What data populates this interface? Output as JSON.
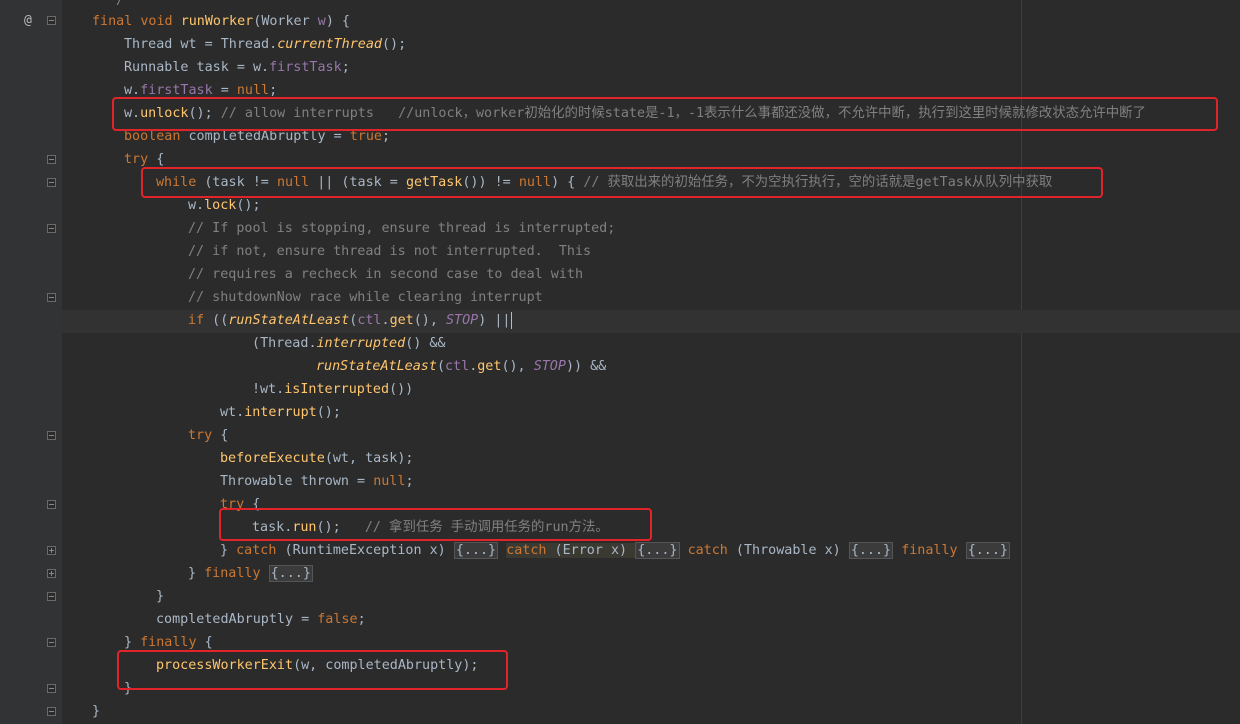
{
  "gutter": {
    "override_marker": "@"
  },
  "code": {
    "l0": "*/",
    "l1": {
      "k1": "final",
      "k2": "void",
      "fn": "runWorker",
      "p1": "(",
      "ty": "Worker",
      "v": "w",
      "p2": ") {"
    },
    "l2": {
      "ty": "Thread",
      "v": " wt = ",
      "cls": "Thread",
      "dot": ".",
      "fn": "currentThread",
      "end": "();"
    },
    "l3": {
      "ty": "Runnable",
      "v": " task = w.",
      "fld": "firstTask",
      "end": ";"
    },
    "l4": {
      "v": "w.",
      "fld": "firstTask",
      "eq": " = ",
      "kw": "null",
      "end": ";"
    },
    "l5": {
      "v": "w.",
      "fn": "unlock",
      "end": "(); ",
      "cmt": "// allow interrupts   //unlock，worker初始化的时候state是-1，-1表示什么事都还没做，不允许中断，执行到这里时候就修改状态允许中断了"
    },
    "l6": {
      "kw": "boolean",
      "v": " completedAbruptly = ",
      "kw2": "true",
      "end": ";"
    },
    "l7": {
      "kw": "try",
      "end": " {"
    },
    "l8": {
      "kw": "while",
      "a": " (task != ",
      "n1": "null",
      "b": " || (task = ",
      "fn": "getTask",
      "c": "()) != ",
      "n2": "null",
      "d": ") { ",
      "cmt": "// 获取出来的初始任务，不为空执行执行，空的话就是getTask从队列中获取"
    },
    "l9": {
      "v": "w.",
      "fn": "lock",
      "end": "();"
    },
    "l10": "// If pool is stopping, ensure thread is interrupted;",
    "l11": "// if not, ensure thread is not interrupted.  This",
    "l12": "// requires a recheck in second case to deal with",
    "l13": "// shutdownNow race while clearing interrupt",
    "l14": {
      "kw": "if",
      "a": " ((",
      "it": "runStateAtLeast",
      "b": "(",
      "fld": "ctl",
      "c": ".",
      "fn": "get",
      "d": "(), ",
      "const": "STOP",
      "e": ") ||"
    },
    "l15": {
      "a": "(",
      "cls": "Thread",
      "b": ".",
      "it": "interrupted",
      "c": "() &&"
    },
    "l16": {
      "it": "runStateAtLeast",
      "a": "(",
      "fld": "ctl",
      "b": ".",
      "fn": "get",
      "c": "(), ",
      "const": "STOP",
      "d": ")) &&"
    },
    "l17": {
      "a": "!wt.",
      "fn": "isInterrupted",
      "b": "())"
    },
    "l18": {
      "a": "wt.",
      "fn": "interrupt",
      "b": "();"
    },
    "l19": {
      "kw": "try",
      "end": " {"
    },
    "l20": {
      "fn": "beforeExecute",
      "a": "(wt, task);"
    },
    "l21": {
      "ty": "Throwable",
      "a": " thrown = ",
      "kw": "null",
      "b": ";"
    },
    "l22": {
      "kw": "try",
      "end": " {"
    },
    "l23": {
      "a": "task.",
      "fn": "run",
      "b": "();   ",
      "cmt": "// 拿到任务 手动调用任务的run方法。"
    },
    "l24": {
      "a": "} ",
      "k1": "catch",
      "b": " (",
      "t1": "RuntimeException",
      "c": " x) ",
      "f1": "{...}",
      "k2": "catch",
      "d": " (",
      "t2": "Error",
      "e": " x) ",
      "f2": "{...}",
      "k3": "catch",
      "g": " (",
      "t3": "Throwable",
      "h": " x) ",
      "f3": "{...}",
      "k4": "finally",
      "f4": "{...}"
    },
    "l25": {
      "a": "} ",
      "kw": "finally",
      "f": "{...}"
    },
    "l26": "}",
    "l27": {
      "a": "completedAbruptly = ",
      "kw": "false",
      "b": ";"
    },
    "l28": {
      "a": "} ",
      "kw": "finally",
      "b": " {"
    },
    "l29": {
      "fn": "processWorkerExit",
      "a": "(w, completedAbruptly);"
    },
    "l30": "}",
    "l31": "}"
  }
}
